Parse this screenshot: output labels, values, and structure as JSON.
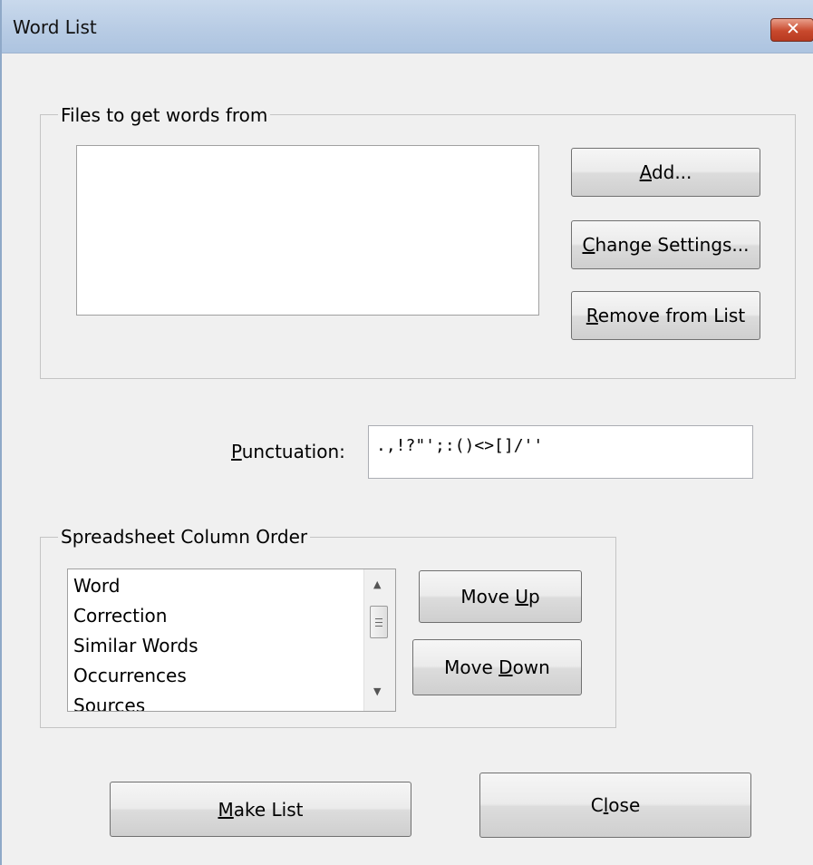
{
  "window": {
    "title": "Word List"
  },
  "files_group": {
    "title": "Files to get words from",
    "add_label_pre": "",
    "add_label_u": "A",
    "add_label_post": "dd...",
    "change_label_pre": "",
    "change_label_u": "C",
    "change_label_post": "hange Settings...",
    "remove_label_pre": "",
    "remove_label_u": "R",
    "remove_label_post": "emove from List"
  },
  "punctuation": {
    "label_u": "P",
    "label_rest": "unctuation:",
    "value": ".,!?\"';:()<>[]/''"
  },
  "column_group": {
    "title": "Spreadsheet Column Order",
    "items": [
      "Word",
      "Correction",
      "Similar Words",
      "Occurrences",
      "Sources"
    ],
    "move_up_pre": "Move ",
    "move_up_u": "U",
    "move_up_post": "p",
    "move_down_pre": "Move ",
    "move_down_u": "D",
    "move_down_post": "own"
  },
  "footer": {
    "make_list_pre": "",
    "make_list_u": "M",
    "make_list_post": "ake List",
    "close_pre": "C",
    "close_u": "l",
    "close_post": "ose"
  },
  "icons": {
    "close": "close-icon",
    "scroll_up": "chevron-up-icon",
    "scroll_down": "chevron-down-icon"
  }
}
